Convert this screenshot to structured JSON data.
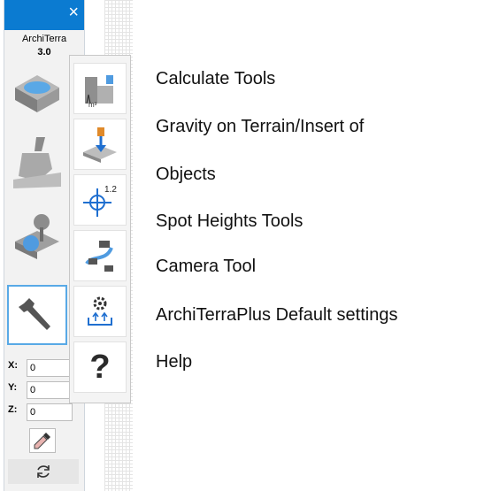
{
  "palette": {
    "app_name": "ArchiTerra",
    "version": "3.0",
    "main_tools": [
      {
        "name": "terrain-tool-icon"
      },
      {
        "name": "excavator-bucket-icon"
      },
      {
        "name": "tree-terrain-icon"
      },
      {
        "name": "wrench-icon",
        "selected": true
      }
    ],
    "sub_tools": [
      {
        "name": "calculate-tools-icon"
      },
      {
        "name": "gravity-insert-icon"
      },
      {
        "name": "spot-height-icon"
      },
      {
        "name": "camera-path-icon"
      },
      {
        "name": "default-settings-icon"
      },
      {
        "name": "help-icon"
      }
    ],
    "coords": [
      {
        "label": "X:",
        "value": "0"
      },
      {
        "label": "Y:",
        "value": "0"
      },
      {
        "label": "Z:",
        "value": "0"
      }
    ],
    "icons": {
      "picker": "eyedropper-icon",
      "refresh": "refresh-icon",
      "close": "close-icon"
    },
    "colors": {
      "titlebar": "#0b7bd1",
      "selection": "#58a9e6"
    }
  },
  "legend": [
    "Calculate Tools",
    "Gravity on Terrain/Insert of",
    "Objects",
    "Spot Heights Tools",
    "Camera Tool",
    "ArchiTerraPlus Default settings",
    "Help"
  ],
  "help_glyph": "?"
}
